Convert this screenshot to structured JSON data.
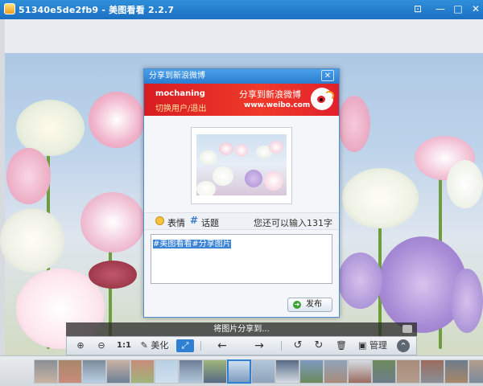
{
  "window": {
    "title": "51340e5de2fb9 - 美图看看 2.2.7",
    "controls": [
      "⊡",
      "—",
      "□",
      "✕"
    ]
  },
  "dialog": {
    "title": "分享到新浪微博",
    "close": "✕",
    "banner": {
      "username": "mochaning",
      "switch_link": "切换用户/退出",
      "slogan": "分享到新浪微博",
      "url": "www.weibo.com"
    },
    "toolbar": {
      "emoji_label": "表情",
      "topic_label": "话题",
      "remaining": "您还可以输入131字"
    },
    "message": "#美图看看#分享图片",
    "publish_label": "发布"
  },
  "status_text": "将图片分享到...",
  "viewer_toolbar": {
    "zoom_in": "⊕",
    "zoom_out": "⊖",
    "actual_size": "1:1",
    "beautify": "美化",
    "fit": "⤢",
    "prev": "←",
    "next": "→",
    "rotate_left": "↺",
    "rotate_right": "↻",
    "delete": "🗑",
    "manage": "管理",
    "collapse": "⌃"
  },
  "colors": {
    "accent_blue": "#2f80d3",
    "weibo_red": "#e2212a",
    "titlebar": "#1b6fc2"
  },
  "filmstrip": {
    "thumb_count": 19,
    "selected_index": 8
  }
}
